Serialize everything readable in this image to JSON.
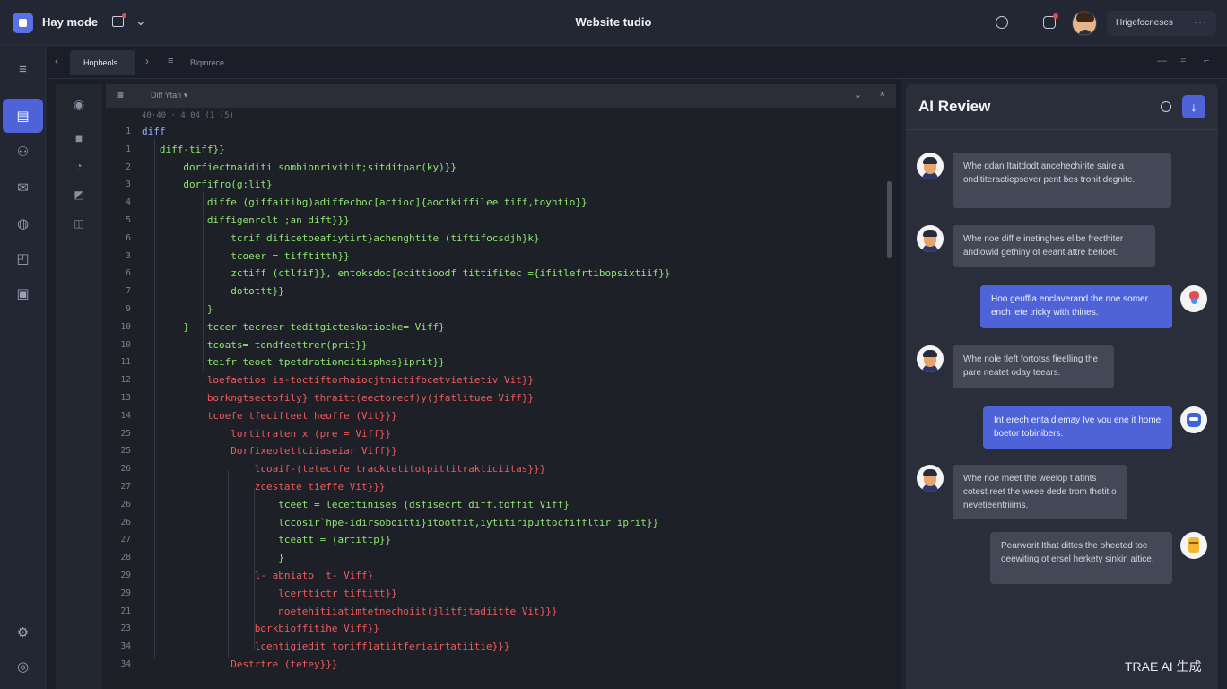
{
  "topbar": {
    "app_name": "Hay mode",
    "center_title": "Website tudio",
    "user_name": "Hrigefocneses",
    "more": "···"
  },
  "tabs": {
    "prev": "‹",
    "next": "›",
    "active": "Hopbeols",
    "second": "Blqmrece",
    "list_icon": "≡"
  },
  "editor": {
    "menu": "≡",
    "label": "Diff Ytan ▾",
    "crumb": "40·40 · 4 04 (1 (5)",
    "chevron": "⌄",
    "close": "×",
    "lines": [
      {
        "n": "1",
        "indent": 0,
        "color": "blue",
        "text": "diff"
      },
      {
        "n": "1",
        "indent": 3,
        "color": "green",
        "text": "diff-tiff}}"
      },
      {
        "n": "2",
        "indent": 7,
        "color": "green",
        "text": "dorfiectnaiditi sombionrivitit;sitditpar(ky)}}"
      },
      {
        "n": "3",
        "indent": 7,
        "color": "green",
        "text": "dorfifro(g:lit}"
      },
      {
        "n": "4",
        "indent": 11,
        "color": "green",
        "text": "diffe (giffaitibg)adiffecboc[actioc]{aoctkiffilee tiff,toyhtio}}"
      },
      {
        "n": "5",
        "indent": 11,
        "color": "green",
        "text": "diffigenrolt ;an dift}}}"
      },
      {
        "n": "6",
        "indent": 15,
        "color": "green",
        "text": "tcrif dificetoeafiytirt}achenghtite (tiftifocsdjh}k}"
      },
      {
        "n": "3",
        "indent": 15,
        "color": "green",
        "text": "tcoeer = tifftitth}}"
      },
      {
        "n": "6",
        "indent": 15,
        "color": "green",
        "text": "zctiff (ctlfif}}, entoksdoc[ocittioodf tittifitec ={ifitlefrtibopsixtiif}}"
      },
      {
        "n": "7",
        "indent": 15,
        "color": "green",
        "text": "dotottt}}"
      },
      {
        "n": "9",
        "indent": 11,
        "color": "green",
        "text": "}"
      },
      {
        "n": "10",
        "indent": 7,
        "color": "green",
        "text": "}   tccer tecreer teditgicteskatiocke= Viff}"
      },
      {
        "n": "10",
        "indent": 11,
        "color": "green",
        "text": "tcoats= tondfeettrer(prit}}"
      },
      {
        "n": "11",
        "indent": 11,
        "color": "green",
        "text": "teifr teoet tpetdrationcitisphes}iprit}}"
      },
      {
        "n": "12",
        "indent": 11,
        "color": "red",
        "text": "loefaetios is-toctiftorhaiocjtnictifbcetvietietiv Vit}}"
      },
      {
        "n": "13",
        "indent": 11,
        "color": "red",
        "text": "borkngtsectofily} thraitt(eectorecf)y(jfatlituee Viff}}"
      },
      {
        "n": "14",
        "indent": 11,
        "color": "red",
        "text": "tcoefe tfecifteet heoffe (Vit}}}"
      },
      {
        "n": "25",
        "indent": 15,
        "color": "red",
        "text": "lortitraten x (pre = Viff}}"
      },
      {
        "n": "25",
        "indent": 15,
        "color": "red",
        "text": "Dorfixeotettciiaseiar Viff}}"
      },
      {
        "n": "26",
        "indent": 19,
        "color": "red",
        "text": "lcoaif-(tetectfe tracktetitotpittitrakticiitas}}}"
      },
      {
        "n": "27",
        "indent": 19,
        "color": "red",
        "text": "zcestate tieffe Vit}}}"
      },
      {
        "n": "26",
        "indent": 23,
        "color": "green",
        "text": "tceet = lecettinises (dsfisecrt diff.toffit Viff}"
      },
      {
        "n": "26",
        "indent": 23,
        "color": "green",
        "text": "lccosir`hpe-idirsoboitti}itootfit,iytitiriputtocfiffltir iprit}}"
      },
      {
        "n": "27",
        "indent": 23,
        "color": "green",
        "text": "tceatt = (artittp}}"
      },
      {
        "n": "28",
        "indent": 23,
        "color": "green",
        "text": "}"
      },
      {
        "n": "29",
        "indent": 19,
        "color": "red",
        "text": "l- abniato  t- Viff}"
      },
      {
        "n": "29",
        "indent": 23,
        "color": "red",
        "text": "lcerttictr tiftitt}}"
      },
      {
        "n": "21",
        "indent": 23,
        "color": "red",
        "text": "noetehitiiatimtetnechoiit(jlitfjtadiitte Vit}}}"
      },
      {
        "n": "23",
        "indent": 19,
        "color": "red",
        "text": "borkbioffitihe Viff}}"
      },
      {
        "n": "34",
        "indent": 19,
        "color": "red",
        "text": "lcentigiedit toriff1atiitferiairtatiitie}}}"
      },
      {
        "n": "34",
        "indent": 15,
        "color": "red",
        "text": "Destrtre (tetey}}}"
      }
    ]
  },
  "ai_panel": {
    "title": "AI Review",
    "send_icon": "↓",
    "messages": [
      {
        "role": "ai",
        "avatar": "person-man",
        "text": "Whe gdan Itaitdodt ancehechirite saire a ondititeractiepsever pent bes tronit degnite."
      },
      {
        "role": "ai",
        "avatar": "person-man",
        "text": "Whe noe diff e inetinghes elibe frecthiter andiowid gethiny ot eeant attre berioet."
      },
      {
        "role": "user",
        "avatar": "pin",
        "text": "Hoo geuffia enclaverand the noe somer ench lete tricky with thines."
      },
      {
        "role": "ai",
        "avatar": "person-man",
        "text": "Whe nole tleft fortotss fieelling the pare neatet oday teears."
      },
      {
        "role": "user",
        "avatar": "mask",
        "text": "Int erech enta diemay Ive vou ene it home boetor tobinibers."
      },
      {
        "role": "ai",
        "avatar": "person-man",
        "text": "Whe noe meet the weelop t atints cotest reet the weee dede trom thetit o nevetieentriiims."
      },
      {
        "role": "ai",
        "avatar": "jar",
        "text": "Pearworit Ithat dittes the oheeted toe oeewiting ot ersel herkety sinkin aitice."
      }
    ]
  },
  "watermark": "TRAE AI 生成"
}
